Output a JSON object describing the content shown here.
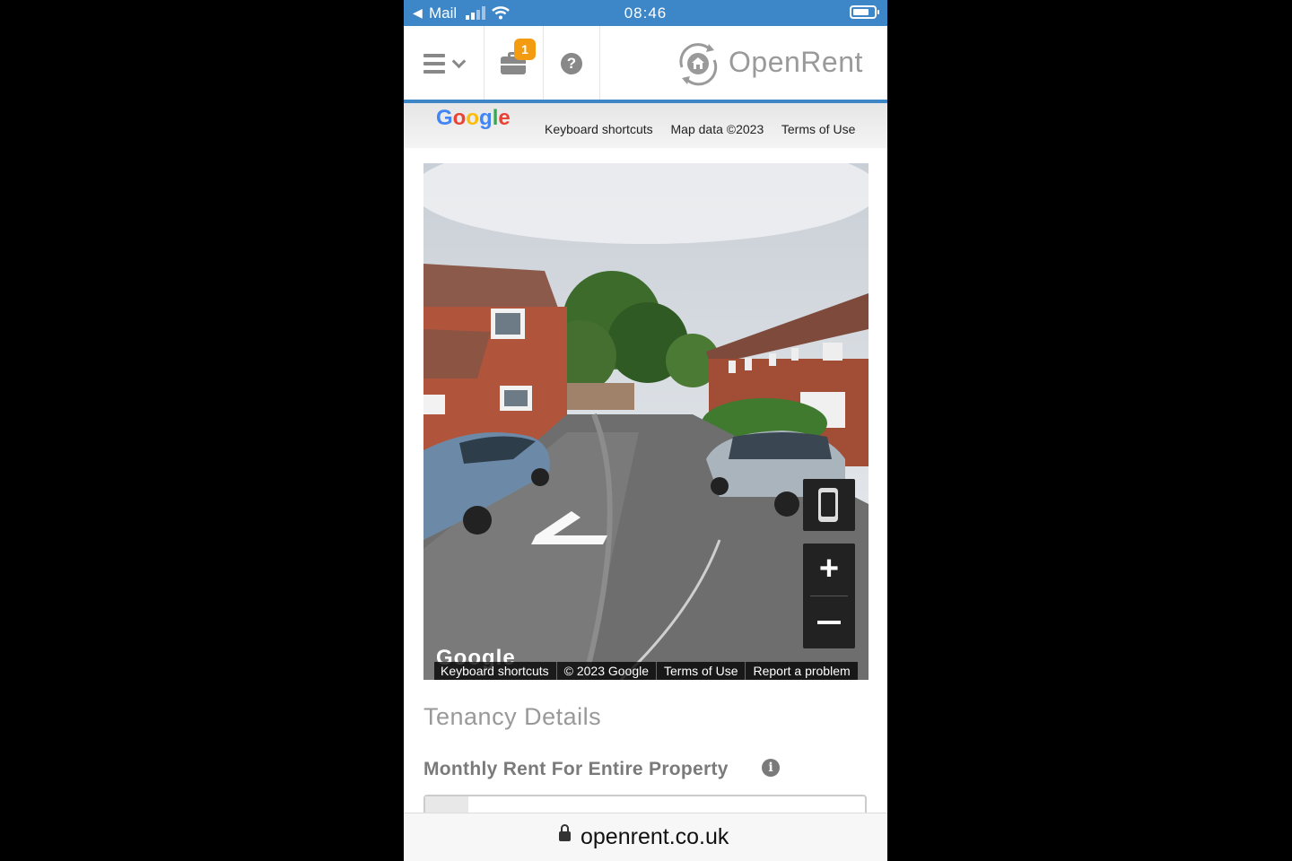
{
  "status_bar": {
    "back_arrow": "◀",
    "carrier": "Mail",
    "time": "08:46",
    "battery_level": 0.75
  },
  "header": {
    "notification_count": "1",
    "help_glyph": "?",
    "logo_text": "OpenRent",
    "accent_color": "#3d86c7",
    "badge_color": "#f39c12"
  },
  "map_strip": {
    "logo_letters": [
      "G",
      "o",
      "o",
      "g",
      "l",
      "e"
    ],
    "links": [
      "Keyboard shortcuts",
      "Map data ©2023",
      "Terms of Use"
    ]
  },
  "street_view": {
    "google_logo": "Google",
    "zoom_in_label": "+",
    "footer_links": [
      "Keyboard shortcuts",
      "© 2023 Google",
      "Terms of Use",
      "Report a problem"
    ]
  },
  "tenancy": {
    "title": "Tenancy Details",
    "rent_label": "Monthly Rent For Entire Property",
    "info_glyph": "i"
  },
  "url_bar": {
    "url": "openrent.co.uk"
  }
}
